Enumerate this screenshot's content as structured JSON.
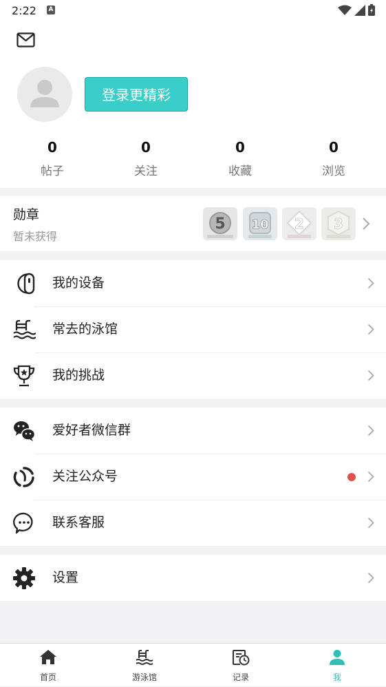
{
  "status_bar": {
    "time": "2:22",
    "notif_letter": "A"
  },
  "profile": {
    "login_label": "登录更精彩",
    "stats": [
      {
        "value": "0",
        "label": "帖子"
      },
      {
        "value": "0",
        "label": "关注"
      },
      {
        "value": "0",
        "label": "收藏"
      },
      {
        "value": "0",
        "label": "浏览"
      }
    ]
  },
  "badges": {
    "title": "勋章",
    "subtitle": "暂未获得",
    "medal_numbers": [
      "5",
      "10",
      "2",
      "3"
    ]
  },
  "menu_groups": [
    {
      "items": [
        {
          "label": "我的设备",
          "icon": "device-icon"
        },
        {
          "label": "常去的泳馆",
          "icon": "swimming-pool-icon"
        },
        {
          "label": "我的挑战",
          "icon": "trophy-icon"
        }
      ]
    },
    {
      "items": [
        {
          "label": "爱好者微信群",
          "icon": "wechat-icon"
        },
        {
          "label": "关注公众号",
          "icon": "official-account-icon",
          "has_dot": true
        },
        {
          "label": "联系客服",
          "icon": "chat-bubble-icon"
        }
      ]
    },
    {
      "items": [
        {
          "label": "设置",
          "icon": "gear-icon"
        }
      ]
    }
  ],
  "tabbar": {
    "accent": "#2dbfb8",
    "tabs": [
      {
        "label": "首页",
        "icon": "home-icon"
      },
      {
        "label": "游泳馆",
        "icon": "pool-icon"
      },
      {
        "label": "记录",
        "icon": "record-icon"
      },
      {
        "label": "我",
        "icon": "person-icon",
        "active": true
      }
    ]
  }
}
